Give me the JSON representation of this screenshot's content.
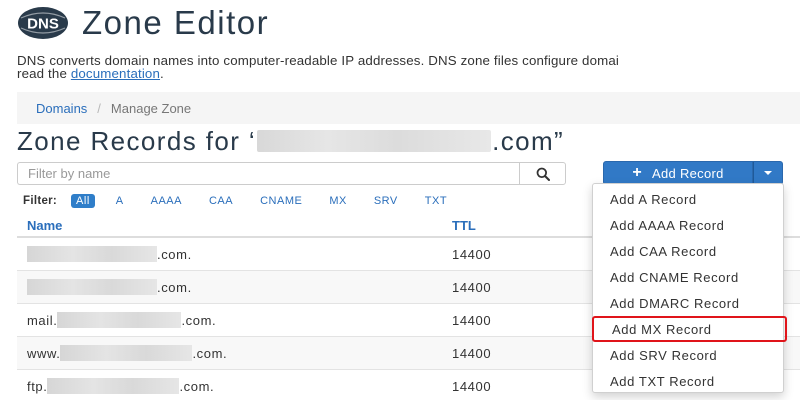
{
  "header": {
    "logo_text": "DNS",
    "title": "Zone Editor"
  },
  "description": {
    "line1": "DNS converts domain names into computer-readable IP addresses. DNS zone files configure domai",
    "line2_prefix": "read the ",
    "link_text": "documentation",
    "line2_suffix": "."
  },
  "breadcrumb": {
    "link": "Domains",
    "separator": "/",
    "current": "Manage Zone"
  },
  "zone": {
    "title_prefix": "Zone Records for ‘",
    "title_suffix": ".com”"
  },
  "search": {
    "placeholder": "Filter by name"
  },
  "add_record": {
    "label": "Add Record",
    "plus": "+"
  },
  "filter": {
    "label": "Filter:",
    "chips": [
      "All",
      "A",
      "AAAA",
      "CAA",
      "CNAME",
      "MX",
      "SRV",
      "TXT"
    ],
    "active": "All"
  },
  "table": {
    "headers": {
      "name": "Name",
      "ttl": "TTL"
    },
    "rows": [
      {
        "prefix": "",
        "suffix": ".com.",
        "ttl": "14400"
      },
      {
        "prefix": "",
        "suffix": ".com.",
        "ttl": "14400"
      },
      {
        "prefix": "mail.",
        "suffix": ".com.",
        "ttl": "14400"
      },
      {
        "prefix": "www.",
        "suffix": ".com.",
        "ttl": "14400"
      },
      {
        "prefix": "ftp.",
        "suffix": ".com.",
        "ttl": "14400"
      }
    ]
  },
  "add_menu": {
    "items": [
      "Add A Record",
      "Add AAAA Record",
      "Add CAA Record",
      "Add CNAME Record",
      "Add DMARC Record",
      "Add MX Record",
      "Add SRV Record",
      "Add TXT Record"
    ],
    "highlighted": "Add MX Record"
  },
  "colors": {
    "brand_dark": "#293a4a",
    "link": "#2a6ebb",
    "primary_button": "#3179c6",
    "highlight_outline": "#e0141a"
  },
  "icons": {
    "logo": "dns-logo-icon",
    "search": "search-icon",
    "add": "plus-icon",
    "caret": "caret-down-icon"
  }
}
